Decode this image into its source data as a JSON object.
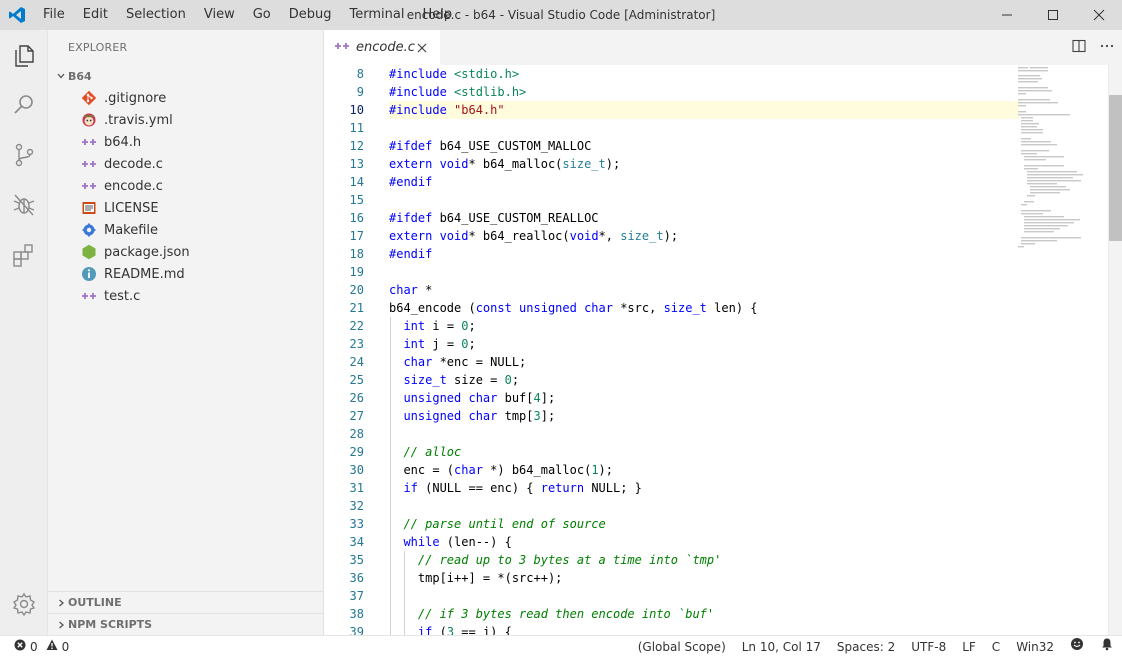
{
  "window": {
    "title": "encode.c - b64 - Visual Studio Code [Administrator]",
    "menu": [
      "File",
      "Edit",
      "Selection",
      "View",
      "Go",
      "Debug",
      "Terminal",
      "Help"
    ]
  },
  "activity_bar": {
    "icons": [
      "files-icon",
      "search-icon",
      "source-control-icon",
      "debug-icon",
      "extensions-icon"
    ],
    "bottom_icon": "settings-gear-icon"
  },
  "sidebar": {
    "title": "EXPLORER",
    "folder": "B64",
    "files": [
      {
        "name": ".gitignore",
        "icon": "git-icon"
      },
      {
        "name": ".travis.yml",
        "icon": "travis-icon"
      },
      {
        "name": "b64.h",
        "icon": "c-header-icon"
      },
      {
        "name": "decode.c",
        "icon": "c-file-icon"
      },
      {
        "name": "encode.c",
        "icon": "c-file-icon"
      },
      {
        "name": "LICENSE",
        "icon": "license-icon"
      },
      {
        "name": "Makefile",
        "icon": "makefile-gear-icon"
      },
      {
        "name": "package.json",
        "icon": "nodejs-icon"
      },
      {
        "name": "README.md",
        "icon": "info-icon"
      },
      {
        "name": "test.c",
        "icon": "c-file-icon"
      }
    ],
    "bottom_sections": [
      "OUTLINE",
      "NPM SCRIPTS"
    ]
  },
  "editor": {
    "tab": {
      "label": "encode.c",
      "icon": "c-file-icon"
    },
    "current_line": 10,
    "lines": [
      {
        "n": "8",
        "t": [
          [
            "pp",
            "#include "
          ],
          [
            "hinc",
            "<stdio.h>"
          ]
        ]
      },
      {
        "n": "9",
        "t": [
          [
            "pp",
            "#include "
          ],
          [
            "hinc",
            "<stdlib.h>"
          ]
        ]
      },
      {
        "n": "10",
        "t": [
          [
            "pp",
            "#include "
          ],
          [
            "str",
            "\"b64.h\""
          ]
        ]
      },
      {
        "n": "11",
        "t": []
      },
      {
        "n": "12",
        "t": [
          [
            "pp",
            "#ifdef "
          ],
          [
            "plain",
            "b64_USE_CUSTOM_MALLOC"
          ]
        ]
      },
      {
        "n": "13",
        "t": [
          [
            "kw",
            "extern "
          ],
          [
            "kw",
            "void"
          ],
          [
            "plain",
            "* b64_malloc("
          ],
          [
            "ty",
            "size_t"
          ],
          [
            "plain",
            ");"
          ]
        ]
      },
      {
        "n": "14",
        "t": [
          [
            "pp",
            "#endif"
          ]
        ]
      },
      {
        "n": "15",
        "t": []
      },
      {
        "n": "16",
        "t": [
          [
            "pp",
            "#ifdef "
          ],
          [
            "plain",
            "b64_USE_CUSTOM_REALLOC"
          ]
        ]
      },
      {
        "n": "17",
        "t": [
          [
            "kw",
            "extern "
          ],
          [
            "kw",
            "void"
          ],
          [
            "plain",
            "* b64_realloc("
          ],
          [
            "kw",
            "void"
          ],
          [
            "plain",
            "*, "
          ],
          [
            "ty",
            "size_t"
          ],
          [
            "plain",
            ");"
          ]
        ]
      },
      {
        "n": "18",
        "t": [
          [
            "pp",
            "#endif"
          ]
        ]
      },
      {
        "n": "19",
        "t": []
      },
      {
        "n": "20",
        "t": [
          [
            "kw",
            "char"
          ],
          [
            "plain",
            " *"
          ]
        ]
      },
      {
        "n": "21",
        "t": [
          [
            "plain",
            "b64_encode ("
          ],
          [
            "kw",
            "const unsigned char"
          ],
          [
            "plain",
            " *src, "
          ],
          [
            "kw",
            "size_t"
          ],
          [
            "plain",
            " len) {"
          ]
        ]
      },
      {
        "n": "22",
        "t": [
          [
            "plain",
            "  "
          ],
          [
            "kw",
            "int"
          ],
          [
            "plain",
            " i = "
          ],
          [
            "num",
            "0"
          ],
          [
            "plain",
            ";"
          ]
        ]
      },
      {
        "n": "23",
        "t": [
          [
            "plain",
            "  "
          ],
          [
            "kw",
            "int"
          ],
          [
            "plain",
            " j = "
          ],
          [
            "num",
            "0"
          ],
          [
            "plain",
            ";"
          ]
        ]
      },
      {
        "n": "24",
        "t": [
          [
            "plain",
            "  "
          ],
          [
            "kw",
            "char"
          ],
          [
            "plain",
            " *enc = NULL;"
          ]
        ]
      },
      {
        "n": "25",
        "t": [
          [
            "plain",
            "  "
          ],
          [
            "kw",
            "size_t"
          ],
          [
            "plain",
            " size = "
          ],
          [
            "num",
            "0"
          ],
          [
            "plain",
            ";"
          ]
        ]
      },
      {
        "n": "26",
        "t": [
          [
            "plain",
            "  "
          ],
          [
            "kw",
            "unsigned char"
          ],
          [
            "plain",
            " buf["
          ],
          [
            "num",
            "4"
          ],
          [
            "plain",
            "];"
          ]
        ]
      },
      {
        "n": "27",
        "t": [
          [
            "plain",
            "  "
          ],
          [
            "kw",
            "unsigned char"
          ],
          [
            "plain",
            " tmp["
          ],
          [
            "num",
            "3"
          ],
          [
            "plain",
            "];"
          ]
        ]
      },
      {
        "n": "28",
        "t": []
      },
      {
        "n": "29",
        "t": [
          [
            "plain",
            "  "
          ],
          [
            "cm",
            "// alloc"
          ]
        ]
      },
      {
        "n": "30",
        "t": [
          [
            "plain",
            "  enc = ("
          ],
          [
            "kw",
            "char"
          ],
          [
            "plain",
            " *) b64_malloc("
          ],
          [
            "num",
            "1"
          ],
          [
            "plain",
            ");"
          ]
        ]
      },
      {
        "n": "31",
        "t": [
          [
            "plain",
            "  "
          ],
          [
            "kw",
            "if"
          ],
          [
            "plain",
            " (NULL == enc) { "
          ],
          [
            "kw",
            "return"
          ],
          [
            "plain",
            " NULL; }"
          ]
        ]
      },
      {
        "n": "32",
        "t": []
      },
      {
        "n": "33",
        "t": [
          [
            "plain",
            "  "
          ],
          [
            "cm",
            "// parse until end of source"
          ]
        ]
      },
      {
        "n": "34",
        "t": [
          [
            "plain",
            "  "
          ],
          [
            "kw",
            "while"
          ],
          [
            "plain",
            " (len--) {"
          ]
        ]
      },
      {
        "n": "35",
        "t": [
          [
            "plain",
            "    "
          ],
          [
            "cm",
            "// read up to 3 bytes at a time into `tmp'"
          ]
        ]
      },
      {
        "n": "36",
        "t": [
          [
            "plain",
            "    tmp[i++] = *(src++);"
          ]
        ]
      },
      {
        "n": "37",
        "t": []
      },
      {
        "n": "38",
        "t": [
          [
            "plain",
            "    "
          ],
          [
            "cm",
            "// if 3 bytes read then encode into `buf'"
          ]
        ]
      },
      {
        "n": "39",
        "t": [
          [
            "plain",
            "    "
          ],
          [
            "kw",
            "if"
          ],
          [
            "plain",
            " ("
          ],
          [
            "num",
            "3"
          ],
          [
            "plain",
            " == i) {"
          ]
        ]
      }
    ]
  },
  "statusbar": {
    "errors": "0",
    "warnings": "0",
    "scope": "(Global Scope)",
    "position": "Ln 10, Col 17",
    "spaces": "Spaces: 2",
    "encoding": "UTF-8",
    "eol": "LF",
    "language": "C",
    "config": "Win32"
  }
}
